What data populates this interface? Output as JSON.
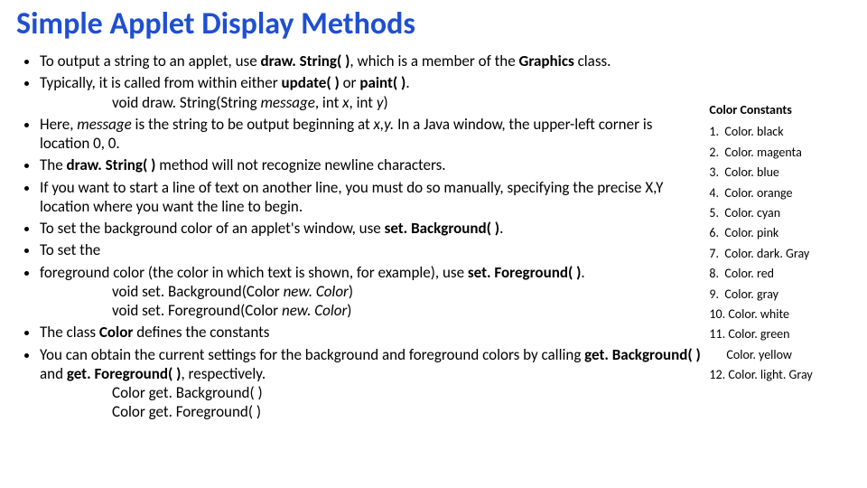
{
  "title": "Simple Applet Display Methods",
  "bullets": {
    "b1a": "To output a string to an applet, use ",
    "b1b": "draw. String( )",
    "b1c": ", which is a member of the ",
    "b1d": "Graphics",
    "b1e": " class.",
    "b2a": "Typically, it is called from within either ",
    "b2b": "update( )",
    "b2c": " or ",
    "b2d": "paint( )",
    "b2e": ".",
    "sig1": "void draw. String(String message, int x, int y)",
    "b3a": "Here, ",
    "b3b": "message",
    "b3c": " is the string to be output beginning at ",
    "b3d": "x,y.",
    "b3e": " In a Java window, the upper-left corner is location 0, 0.",
    "b4a": "The ",
    "b4b": "draw. String( )",
    "b4c": " method will not recognize newline characters.",
    "b5": "If you want to start a line of text on another line, you must do so manually, specifying the precise X,Y location where you want the line to begin.",
    "b6a": "To set the background color of an applet's window, use ",
    "b6b": "set. Background( )",
    "b6c": ".",
    "b7": "To set the",
    "b8a": "foreground color (the color in which text is shown, for example), use ",
    "b8b": "set. Foreground( )",
    "b8c": ".",
    "sig2": "void set. Background(Color new. Color)",
    "sig3": "void set. Foreground(Color new. Color)",
    "b9a": "The class ",
    "b9b": "Color",
    "b9c": " defines the constants",
    "b10a": "You can obtain the current settings for the background and foreground colors by calling ",
    "b10b": "get. Background( )",
    "b10c": " and ",
    "b10d": "get. Foreground( )",
    "b10e": ", respectively.",
    "sig4": "Color get. Background( )",
    "sig5": "Color get. Foreground( )"
  },
  "right_heading": "Color Constants",
  "colors": {
    "c1a": "Color. black",
    "c1b": "Color. magenta",
    "c2a": "Color. blue",
    "c2b": "Color. orange",
    "c3a": "Color. cyan",
    "c3b": "Color. pink",
    "c4a": "Color. dark. Gray",
    "c4b": "Color. red",
    "c5a": "Color. gray",
    "c5b": "Color. white",
    "c6a": "Color. green",
    "c6b": "Color. yellow",
    "c7a": "Color. light. Gray"
  },
  "nums": {
    "n1": "1.",
    "n2": "2.",
    "n3": "3.",
    "n4": "4.",
    "n5": "5.",
    "n6": "6.",
    "n7": "7.",
    "n8": "8.",
    "n9": "9.",
    "n10": "10.",
    "n11": "11.",
    "n12": "12."
  }
}
